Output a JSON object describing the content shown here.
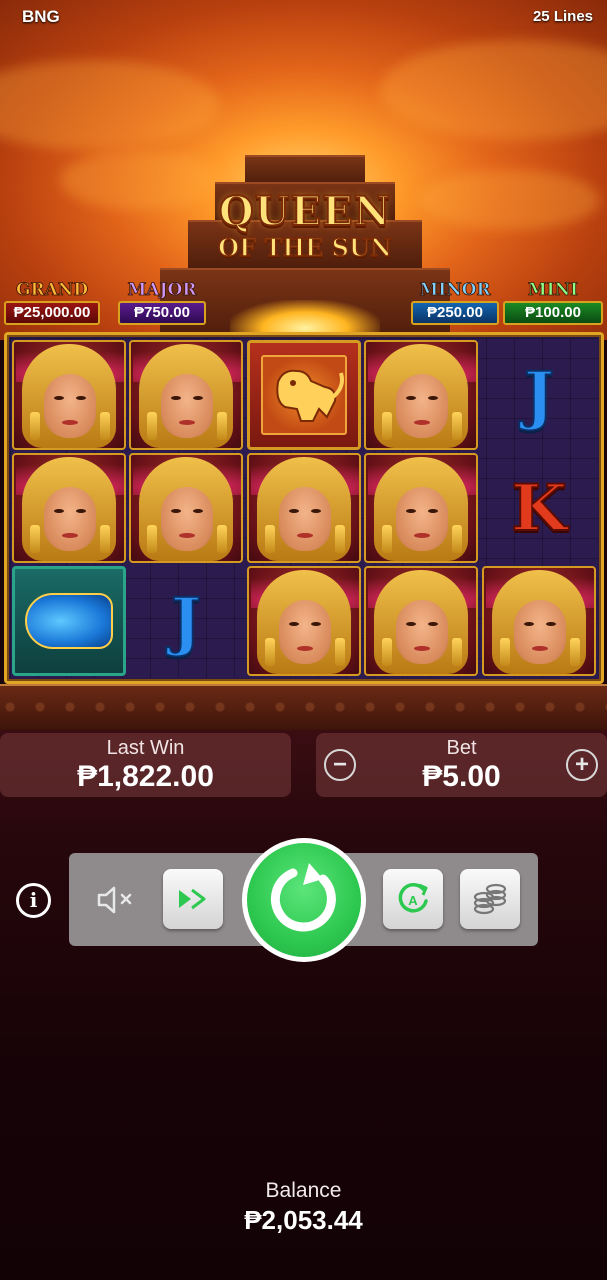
{
  "header": {
    "provider": "BNG",
    "lines": "25 Lines"
  },
  "logo": {
    "line1": "QUEEN",
    "line2": "OF THE SUN"
  },
  "jackpots": {
    "grand": {
      "title": "GRAND",
      "value": "₱25,000.00"
    },
    "major": {
      "title": "MAJOR",
      "value": "₱750.00"
    },
    "minor": {
      "title": "MINOR",
      "value": "₱250.00"
    },
    "mini": {
      "title": "MINI",
      "value": "₱100.00"
    }
  },
  "reels": {
    "grid": [
      [
        "queen",
        "queen",
        "monkey",
        "queen",
        "J"
      ],
      [
        "queen",
        "queen",
        "queen",
        "queen",
        "K"
      ],
      [
        "fish",
        "J",
        "queen",
        "queen",
        "queen"
      ]
    ],
    "letters": {
      "j1": "J",
      "k1": "K",
      "j2": "J"
    }
  },
  "last_win": {
    "label": "Last Win",
    "value": "₱1,822.00"
  },
  "bet": {
    "label": "Bet",
    "value": "₱5.00",
    "minus": "−",
    "plus": "+"
  },
  "controls": {
    "info": "i",
    "icons": [
      "info-icon",
      "sound-muted-icon",
      "turbo-icon",
      "spin-icon",
      "autoplay-icon",
      "coins-icon"
    ]
  },
  "balance": {
    "label": "Balance",
    "value": "₱2,053.44"
  },
  "colors": {
    "spin": "#2dc84f",
    "frame_gold": "#e0a524",
    "reel_bg": "#2c1b4e"
  }
}
